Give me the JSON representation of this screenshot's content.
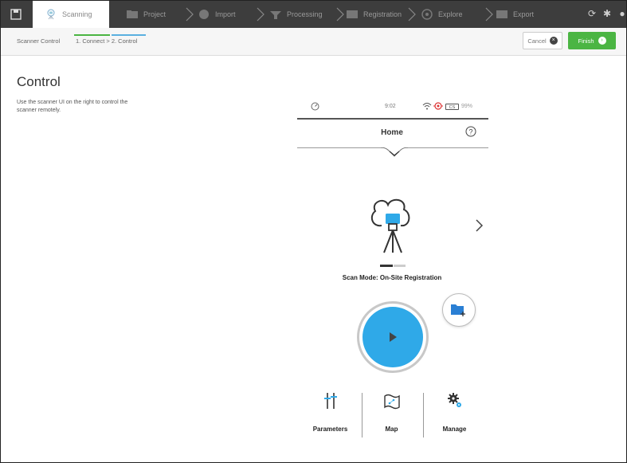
{
  "nav": {
    "tabs": [
      {
        "label": "Scanning",
        "icon": "scanner-icon"
      },
      {
        "label": "Project",
        "icon": "project-icon"
      },
      {
        "label": "Import",
        "icon": "import-icon"
      },
      {
        "label": "Processing",
        "icon": "processing-icon"
      },
      {
        "label": "Registration",
        "icon": "registration-icon"
      },
      {
        "label": "Explore",
        "icon": "explore-icon"
      },
      {
        "label": "Export",
        "icon": "export-icon"
      }
    ],
    "right_icons": [
      "refresh-icon",
      "settings-icon",
      "help-icon"
    ]
  },
  "subheader": {
    "breadcrumb_root": "Scanner Control",
    "steps": "1. Connect > 2. Control",
    "cancel_label": "Cancel",
    "finish_label": "Finish"
  },
  "left": {
    "title": "Control",
    "description": "Use the scanner UI on the right to control the scanner remotely."
  },
  "scanner": {
    "time": "9:02",
    "battery_level": "CS",
    "battery_pct": "99%",
    "screen_title": "Home",
    "scan_mode": "Scan Mode: On-Site Registration",
    "menu": [
      {
        "label": "Parameters"
      },
      {
        "label": "Map"
      },
      {
        "label": "Manage"
      }
    ]
  },
  "colors": {
    "nav_bg": "#3d3d3d",
    "finish_green": "#4bb543",
    "accent_blue": "#2fa9e8"
  }
}
